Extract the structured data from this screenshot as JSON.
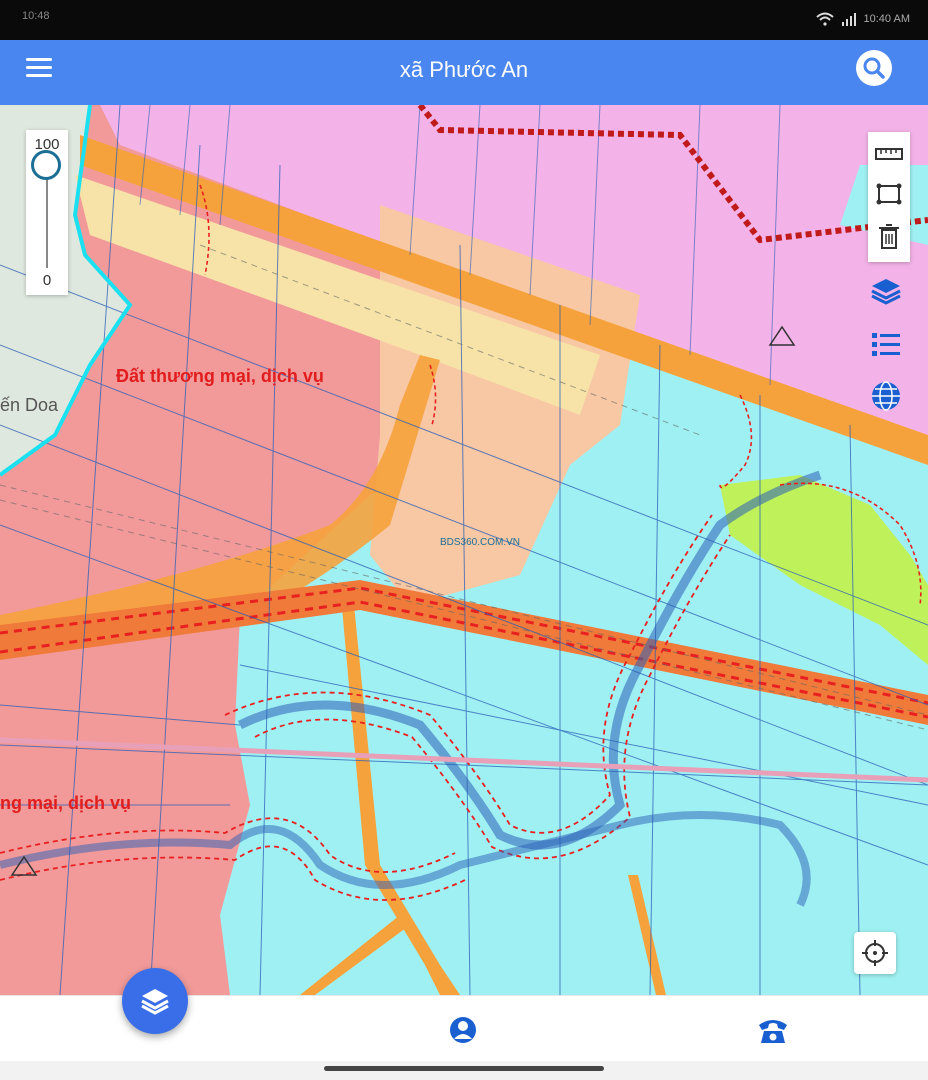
{
  "status_bar": {
    "time": "10:48",
    "clock": "10:40 AM"
  },
  "header": {
    "title": "xã Phước An",
    "menu_icon": "menu-icon",
    "search_icon": "search-icon"
  },
  "map": {
    "zone_labels": [
      "Đất thương mại, dịch vụ",
      "ng mại, dịch vụ"
    ],
    "place_labels": [
      "ến Doa"
    ],
    "watermarks": [
      "BDS360.COM.VN"
    ],
    "colors": {
      "commercial": "#f29a9a",
      "residential": "#f3b3e8",
      "agriculture": "#9ff0f2",
      "road": "#f6a23c",
      "residential_yellow": "#f7e3a8",
      "green": "#bff25a",
      "rail": "#e82020",
      "boundary": "#1ab0e0",
      "parcel": "#2b5fb8"
    }
  },
  "zoom_slider": {
    "max_label": "100",
    "min_label": "0"
  },
  "tools": [
    "ruler-icon",
    "area-measure-icon",
    "trash-icon",
    "layers-icon",
    "legend-list-icon",
    "globe-icon"
  ],
  "bottom_nav": {
    "fab_icon": "layers-icon",
    "profile_icon": "user-icon",
    "phone_icon": "phone-icon"
  }
}
